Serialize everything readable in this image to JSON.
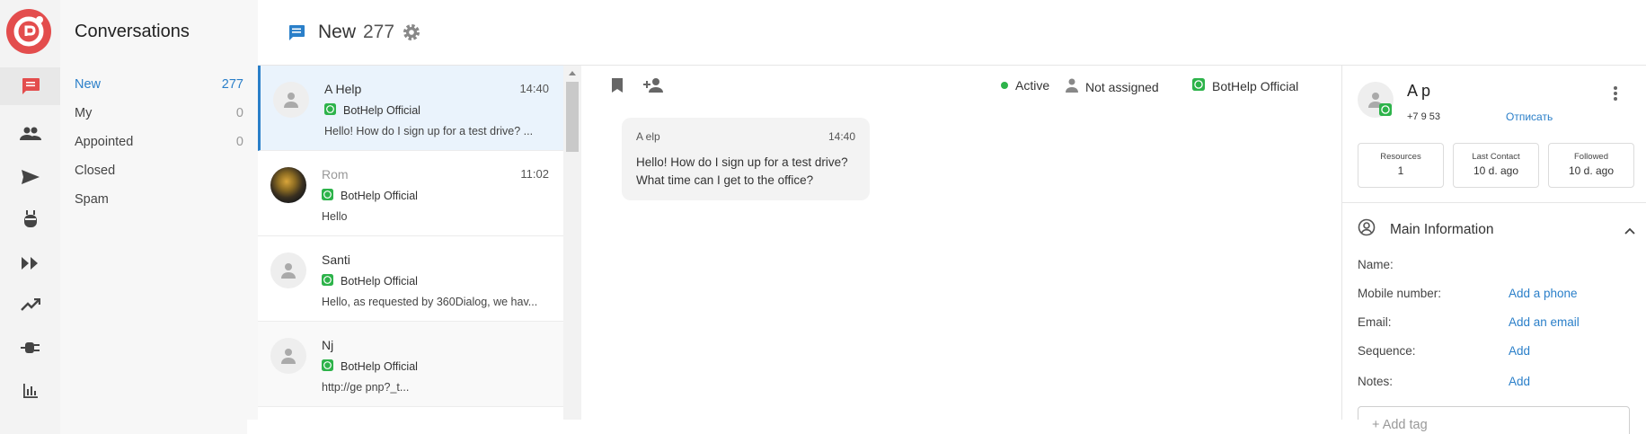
{
  "folders": {
    "title": "Conversations",
    "items": [
      {
        "label": "New",
        "count": "277"
      },
      {
        "label": "My",
        "count": "0"
      },
      {
        "label": "Appointed",
        "count": "0"
      },
      {
        "label": "Closed",
        "count": ""
      },
      {
        "label": "Spam",
        "count": ""
      }
    ]
  },
  "header": {
    "title": "New",
    "count": "277"
  },
  "conversations": [
    {
      "name": "A        Help",
      "time": "14:40",
      "channel": "BotHelp Official",
      "preview": "Hello! How do I sign up for a test drive? ..."
    },
    {
      "name": "Rom",
      "time": "11:02",
      "channel": "BotHelp Official",
      "preview": "Hello"
    },
    {
      "name": "Santi",
      "time": "",
      "channel": "BotHelp Official",
      "preview": "Hello, as requested by 360Dialog, we hav..."
    },
    {
      "name": "Nj",
      "time": "",
      "channel": "BotHelp Official",
      "preview": "http://ge                       pnp?_t..."
    }
  ],
  "chat": {
    "status_active": "Active",
    "assignee": "Not assigned",
    "channel": "BotHelp Official",
    "message": {
      "sender": "A        elp",
      "time": "14:40",
      "line1": "Hello! How do I sign up for a test drive?",
      "line2": "What time can I get to the office?"
    }
  },
  "contact": {
    "name": "A              p",
    "phone": "+7 9           53",
    "unsubscribe": "Отписать",
    "stats": [
      {
        "label": "Resources",
        "value": "1"
      },
      {
        "label": "Last Contact",
        "value": "10 d. ago"
      },
      {
        "label": "Followed",
        "value": "10 d. ago"
      }
    ],
    "section_title": "Main Information",
    "fields": [
      {
        "label": "Name:",
        "value": ""
      },
      {
        "label": "Mobile number:",
        "value": "Add a phone"
      },
      {
        "label": "Email:",
        "value": "Add an email"
      },
      {
        "label": "Sequence:",
        "value": "Add"
      },
      {
        "label": "Notes:",
        "value": "Add"
      }
    ],
    "tag_placeholder": "+ Add tag"
  },
  "colors": {
    "accent": "#2a7fc9",
    "brand": "#e34d4d",
    "whatsapp": "#2db34a",
    "active_dot": "#2db34a"
  }
}
